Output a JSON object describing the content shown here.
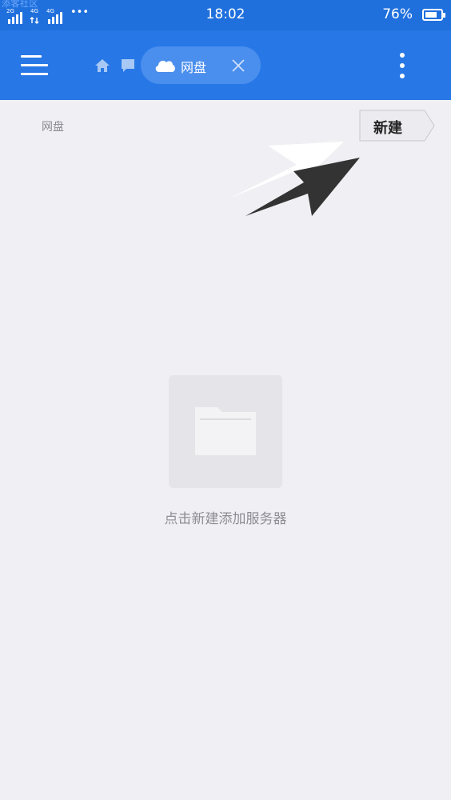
{
  "status_bar": {
    "watermark": "添客社区",
    "signal_1": "2G",
    "signal_2": "4G",
    "signal_3": "4G",
    "more_dots": "•••",
    "time": "18:02",
    "battery_percent": "76%",
    "battery_level": 0.76
  },
  "app_bar": {
    "menu_icon": "hamburger-menu-icon",
    "home_icon": "home-icon",
    "chat_icon": "chat-icon",
    "active_tab": {
      "icon": "cloud-icon",
      "label": "网盘",
      "close_icon": "close-icon"
    },
    "more_icon": "more-vertical-icon"
  },
  "breadcrumb": "网盘",
  "new_button_label": "新建",
  "empty_state": {
    "icon": "folder-icon",
    "message": "点击新建添加服务器"
  },
  "colors": {
    "status_bar": "#1f70dd",
    "app_bar": "#2778e6",
    "tab_chip": "#4a8eee",
    "background": "#f0f0f4"
  }
}
